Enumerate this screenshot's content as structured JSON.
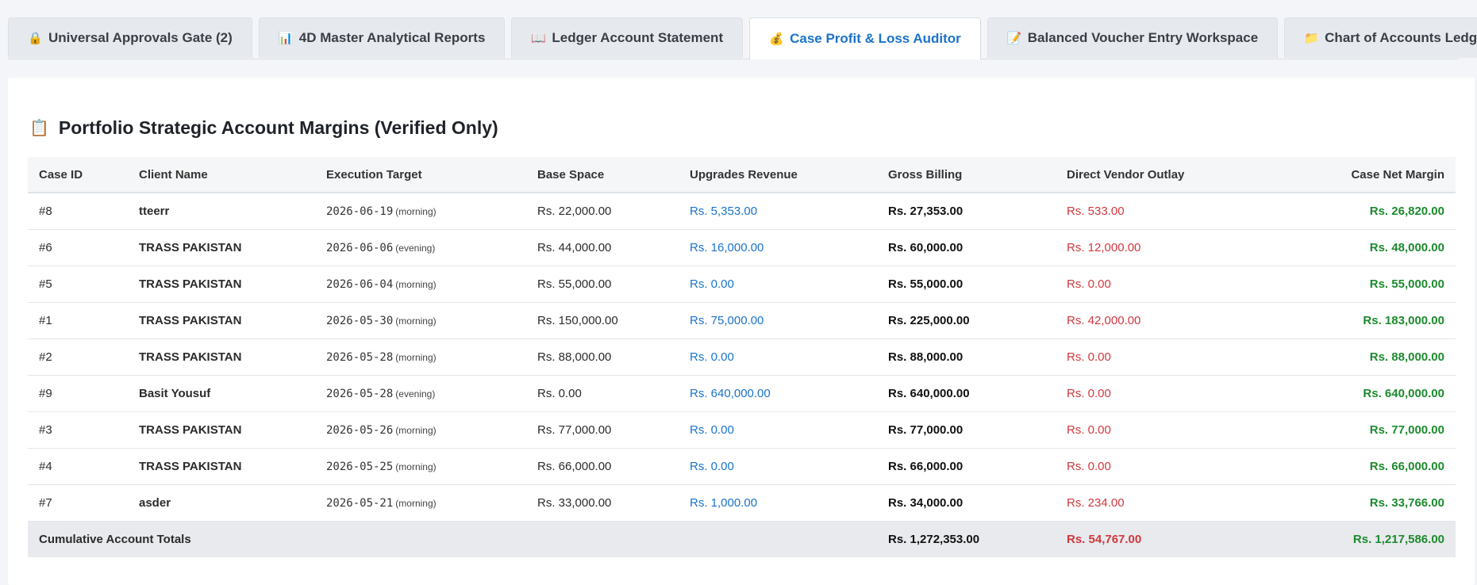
{
  "tabs": [
    {
      "icon": "lock-icon",
      "glyph": "🔒",
      "label": "Universal Approvals Gate (2)"
    },
    {
      "icon": "bar-chart-icon",
      "glyph": "📊",
      "label": "4D Master Analytical Reports"
    },
    {
      "icon": "book-icon",
      "glyph": "📖",
      "label": "Ledger Account Statement"
    },
    {
      "icon": "money-bag-icon",
      "glyph": "💰",
      "label": "Case Profit & Loss Auditor"
    },
    {
      "icon": "memo-icon",
      "glyph": "📝",
      "label": "Balanced Voucher Entry Workspace"
    },
    {
      "icon": "folder-icon",
      "glyph": "📁",
      "label": "Chart of Accounts Ledger Map"
    }
  ],
  "active_tab": "Case Profit & Loss Auditor",
  "section": {
    "icon": "clipboard-icon",
    "glyph": "📋",
    "title": "Portfolio Strategic Account Margins (Verified Only)"
  },
  "table": {
    "columns": [
      "Case ID",
      "Client Name",
      "Execution Target",
      "Base Space",
      "Upgrades Revenue",
      "Gross Billing",
      "Direct Vendor Outlay",
      "Case Net Margin"
    ],
    "rows": [
      {
        "id": "#8",
        "client": "tteerr",
        "date": "2026-06-19",
        "slot": "(morning)",
        "base": "Rs. 22,000.00",
        "upgrades": "Rs. 5,353.00",
        "gross": "Rs. 27,353.00",
        "vendor": "Rs. 533.00",
        "net": "Rs. 26,820.00"
      },
      {
        "id": "#6",
        "client": "TRASS PAKISTAN",
        "date": "2026-06-06",
        "slot": "(evening)",
        "base": "Rs. 44,000.00",
        "upgrades": "Rs. 16,000.00",
        "gross": "Rs. 60,000.00",
        "vendor": "Rs. 12,000.00",
        "net": "Rs. 48,000.00"
      },
      {
        "id": "#5",
        "client": "TRASS PAKISTAN",
        "date": "2026-06-04",
        "slot": "(morning)",
        "base": "Rs. 55,000.00",
        "upgrades": "Rs. 0.00",
        "gross": "Rs. 55,000.00",
        "vendor": "Rs. 0.00",
        "net": "Rs. 55,000.00"
      },
      {
        "id": "#1",
        "client": "TRASS PAKISTAN",
        "date": "2026-05-30",
        "slot": "(morning)",
        "base": "Rs. 150,000.00",
        "upgrades": "Rs. 75,000.00",
        "gross": "Rs. 225,000.00",
        "vendor": "Rs. 42,000.00",
        "net": "Rs. 183,000.00"
      },
      {
        "id": "#2",
        "client": "TRASS PAKISTAN",
        "date": "2026-05-28",
        "slot": "(morning)",
        "base": "Rs. 88,000.00",
        "upgrades": "Rs. 0.00",
        "gross": "Rs. 88,000.00",
        "vendor": "Rs. 0.00",
        "net": "Rs. 88,000.00"
      },
      {
        "id": "#9",
        "client": "Basit Yousuf",
        "date": "2026-05-28",
        "slot": "(evening)",
        "base": "Rs. 0.00",
        "upgrades": "Rs. 640,000.00",
        "gross": "Rs. 640,000.00",
        "vendor": "Rs. 0.00",
        "net": "Rs. 640,000.00"
      },
      {
        "id": "#3",
        "client": "TRASS PAKISTAN",
        "date": "2026-05-26",
        "slot": "(morning)",
        "base": "Rs. 77,000.00",
        "upgrades": "Rs. 0.00",
        "gross": "Rs. 77,000.00",
        "vendor": "Rs. 0.00",
        "net": "Rs. 77,000.00"
      },
      {
        "id": "#4",
        "client": "TRASS PAKISTAN",
        "date": "2026-05-25",
        "slot": "(morning)",
        "base": "Rs. 66,000.00",
        "upgrades": "Rs. 0.00",
        "gross": "Rs. 66,000.00",
        "vendor": "Rs. 0.00",
        "net": "Rs. 66,000.00"
      },
      {
        "id": "#7",
        "client": "asder",
        "date": "2026-05-21",
        "slot": "(morning)",
        "base": "Rs. 33,000.00",
        "upgrades": "Rs. 1,000.00",
        "gross": "Rs. 34,000.00",
        "vendor": "Rs. 234.00",
        "net": "Rs. 33,766.00"
      }
    ],
    "totals": {
      "label": "Cumulative Account Totals",
      "gross": "Rs. 1,272,353.00",
      "vendor": "Rs. 54,767.00",
      "net": "Rs. 1,217,586.00"
    }
  },
  "colors": {
    "accent": "#1a73c9",
    "outlay": "#d0383e",
    "margin": "#1d8a2e"
  }
}
